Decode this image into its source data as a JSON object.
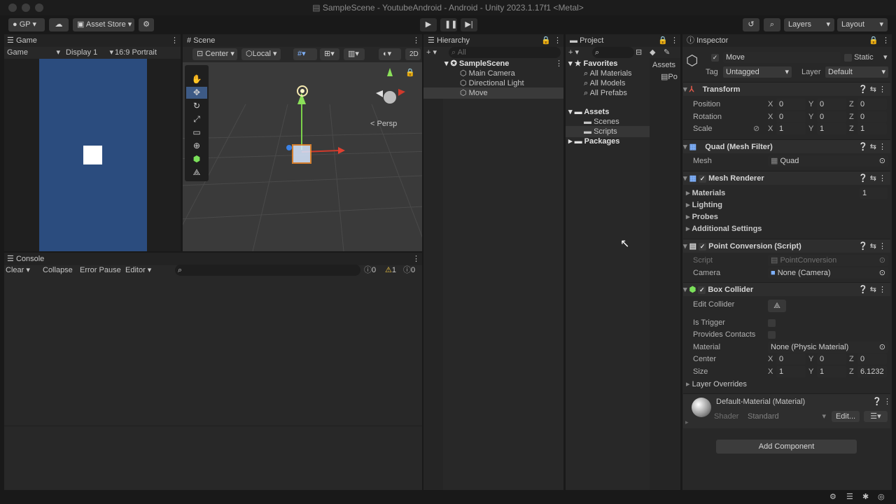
{
  "window": {
    "title": "SampleScene - YoutubeAndroid - Android - Unity 2023.1.17f1 <Metal>"
  },
  "toolbar": {
    "account": "GP",
    "asset_store": "Asset Store",
    "layers": "Layers",
    "layout": "Layout"
  },
  "game": {
    "tab": "Game",
    "mode": "Game",
    "display": "Display 1",
    "aspect": "16:9 Portrait",
    "bg_color": "#2b4c7e"
  },
  "scene": {
    "tab": "Scene",
    "pivot": "Center",
    "space": "Local",
    "mode2d": "2D",
    "persp": "< Persp"
  },
  "hierarchy": {
    "tab": "Hierarchy",
    "search": "All",
    "scene_name": "SampleScene",
    "items": [
      "Main Camera",
      "Directional Light",
      "Move"
    ]
  },
  "project": {
    "tab": "Project",
    "favorites": "Favorites",
    "fav_items": [
      "All Materials",
      "All Models",
      "All Prefabs"
    ],
    "assets": "Assets",
    "asset_items": [
      "Scenes",
      "Scripts"
    ],
    "packages": "Packages",
    "right_header": "Assets",
    "right_item": "Po"
  },
  "console": {
    "tab": "Console",
    "clear": "Clear",
    "collapse": "Collapse",
    "error_pause": "Error Pause",
    "editor": "Editor",
    "count_info": "0",
    "count_warn": "1",
    "count_err": "0"
  },
  "inspector": {
    "tab": "Inspector",
    "object_name": "Move",
    "static": "Static",
    "tag_label": "Tag",
    "tag": "Untagged",
    "layer_label": "Layer",
    "layer": "Default",
    "transform": {
      "title": "Transform",
      "position_label": "Position",
      "position": [
        "0",
        "0",
        "0"
      ],
      "rotation_label": "Rotation",
      "rotation": [
        "0",
        "0",
        "0"
      ],
      "scale_label": "Scale",
      "scale": [
        "1",
        "1",
        "1"
      ]
    },
    "axes": [
      "X",
      "Y",
      "Z"
    ],
    "mesh_filter": {
      "title": "Quad (Mesh Filter)",
      "mesh_label": "Mesh",
      "mesh": "Quad"
    },
    "mesh_renderer": {
      "title": "Mesh Renderer",
      "sections": [
        "Materials",
        "Lighting",
        "Probes",
        "Additional Settings"
      ],
      "materials_count": "1"
    },
    "point_conversion": {
      "title": "Point Conversion (Script)",
      "script_label": "Script",
      "script": "PointConversion",
      "camera_label": "Camera",
      "camera": "None (Camera)"
    },
    "box_collider": {
      "title": "Box Collider",
      "edit_collider": "Edit Collider",
      "is_trigger": "Is Trigger",
      "provides_contacts": "Provides Contacts",
      "material_label": "Material",
      "material": "None (Physic Material)",
      "center_label": "Center",
      "center": [
        "0",
        "0",
        "0"
      ],
      "size_label": "Size",
      "size": [
        "1",
        "1",
        "6.1232"
      ],
      "layer_overrides": "Layer Overrides"
    },
    "material": {
      "title": "Default-Material (Material)",
      "shader_label": "Shader",
      "shader": "Standard",
      "edit": "Edit..."
    },
    "add_component": "Add Component"
  }
}
